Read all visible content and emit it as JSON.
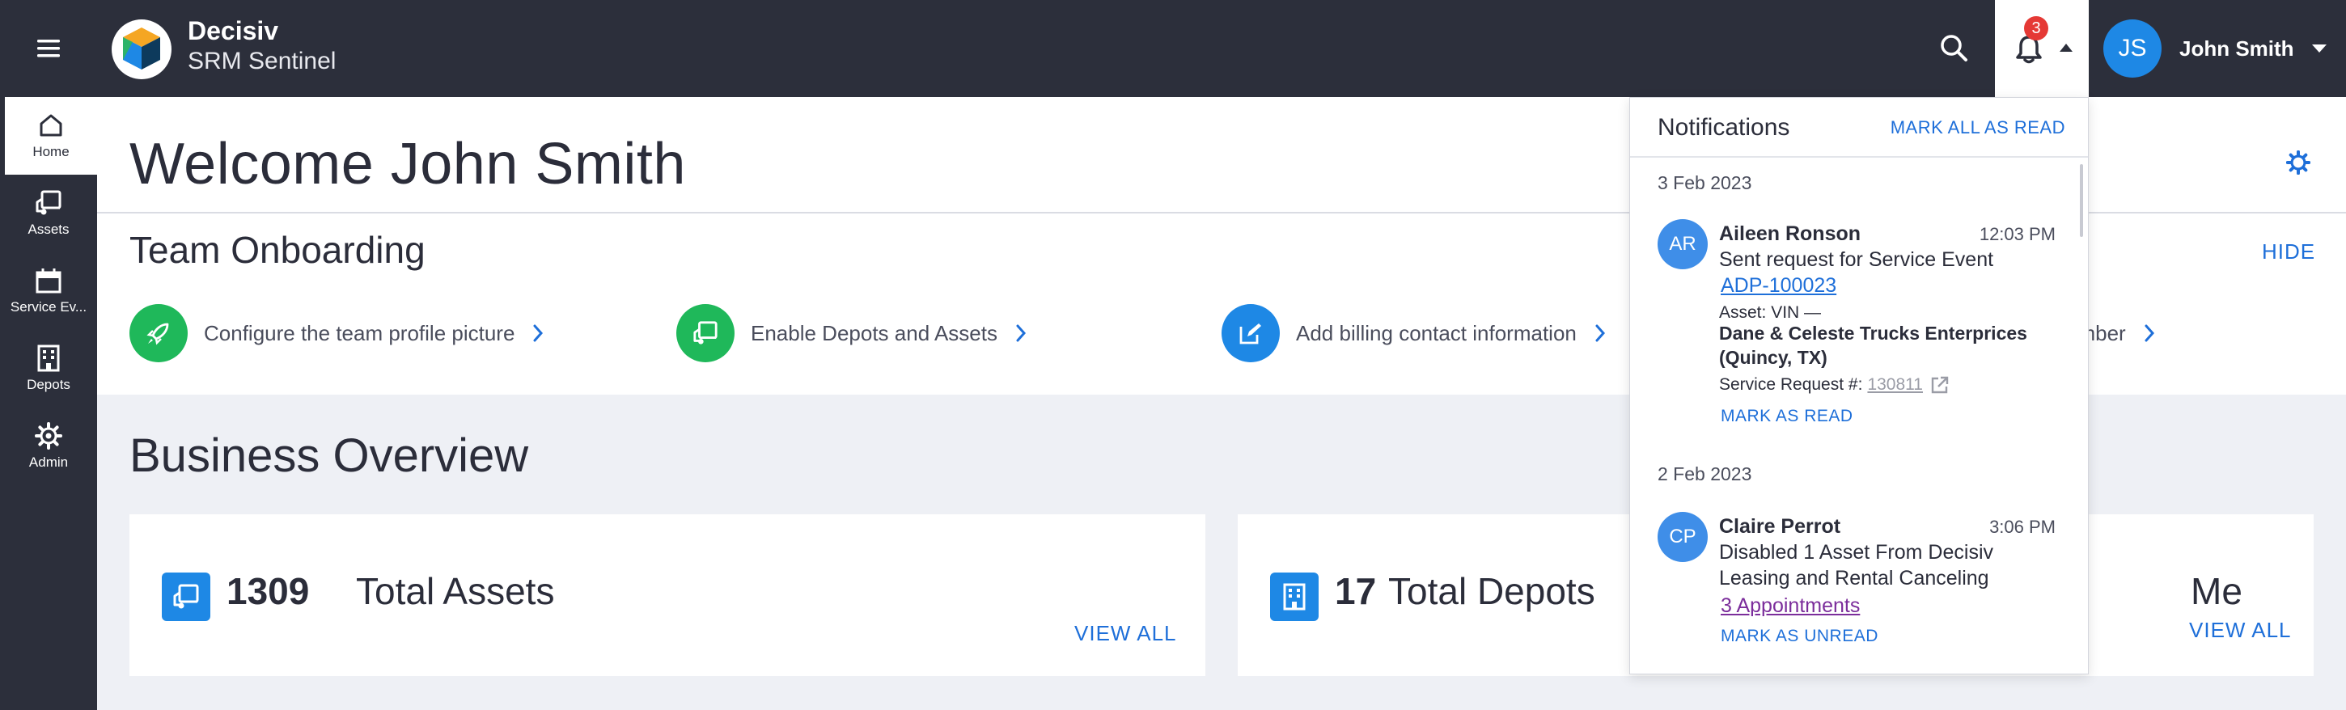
{
  "app": {
    "brand_name": "Decisiv",
    "brand_sub": "SRM Sentinel",
    "notification_count": "3",
    "user_initials": "JS",
    "user_name": "John Smith"
  },
  "sidebar": {
    "items": [
      {
        "label": "Home",
        "icon": "home-icon",
        "active": true
      },
      {
        "label": "Assets",
        "icon": "truck-icon",
        "active": false
      },
      {
        "label": "Service Ev...",
        "icon": "calendar-icon",
        "active": false
      },
      {
        "label": "Depots",
        "icon": "building-icon",
        "active": false
      },
      {
        "label": "Admin",
        "icon": "gear-icon",
        "active": false
      }
    ]
  },
  "welcome": {
    "title": "Welcome John Smith"
  },
  "onboarding": {
    "title": "Team Onboarding",
    "hide_label": "HIDE",
    "steps": [
      {
        "label": "Configure the team profile picture",
        "icon": "rocket-icon",
        "color": "#1fb85a"
      },
      {
        "label": "Enable Depots and Assets",
        "icon": "truck-icon",
        "color": "#1fb85a"
      },
      {
        "label": "Add billing contact information",
        "icon": "edit-icon",
        "color": "#1e88e5"
      },
      {
        "label": "ember",
        "icon": "",
        "color": ""
      }
    ]
  },
  "overview": {
    "title": "Business Overview",
    "cards": [
      {
        "value": "1309",
        "label": "Total Assets",
        "link": "VIEW ALL",
        "icon": "truck-icon"
      },
      {
        "value": "17",
        "label": "Total Depots",
        "link": "",
        "icon": "building-icon"
      },
      {
        "value": "",
        "label": "Me",
        "link": "VIEW  ALL",
        "icon": ""
      }
    ]
  },
  "notifications": {
    "title": "Notifications",
    "mark_all": "MARK ALL AS READ",
    "groups": [
      {
        "date": "3 Feb 2023",
        "initials": "AR",
        "name": "Aileen Ronson",
        "time": "12:03 PM",
        "text": "Sent request for Service Event",
        "link": "ADP-100023",
        "asset_line": "Asset: VIN —",
        "company": "Dane & Celeste Trucks Enterprices (Quincy, TX)",
        "sr_label": "Service Request #:",
        "sr_number": "130811",
        "action": "MARK AS READ"
      },
      {
        "date": "2 Feb 2023",
        "initials": "CP",
        "name": "Claire Perrot",
        "time": "3:06 PM",
        "text": "Disabled 1 Asset From Decisiv Leasing and Rental Canceling",
        "link": "3 Appointments",
        "action": "MARK AS UNREAD"
      }
    ]
  },
  "colors": {
    "topbar": "#2c2f3b",
    "accent": "#1e6fd9",
    "badge": "#e53935",
    "green": "#1fb85a",
    "blue": "#1e88e5"
  }
}
